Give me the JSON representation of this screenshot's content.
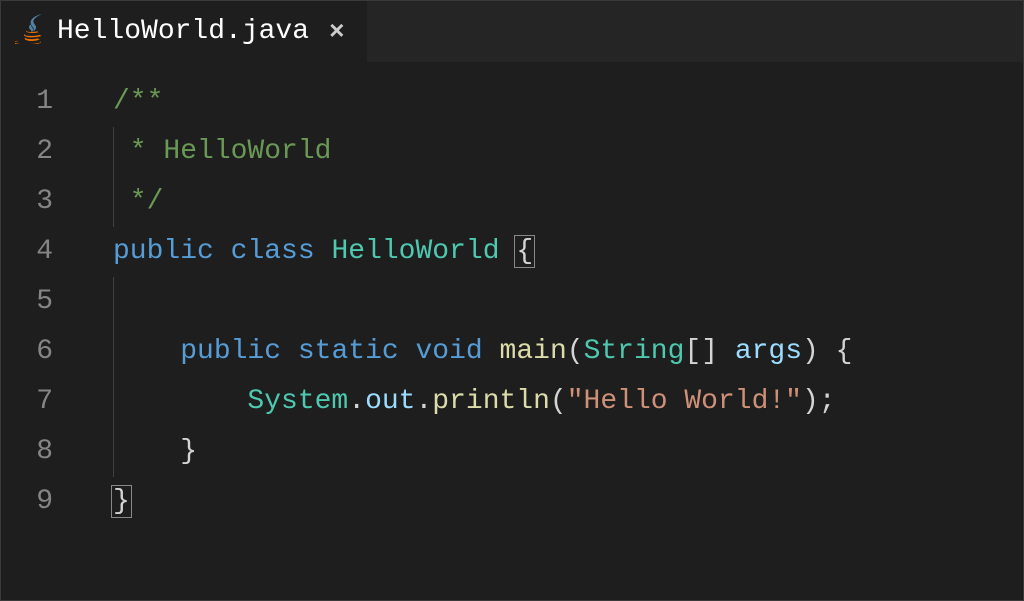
{
  "tab": {
    "filename": "HelloWorld.java",
    "icon": "java-icon"
  },
  "gutter": {
    "lines": [
      "1",
      "2",
      "3",
      "4",
      "5",
      "6",
      "7",
      "8",
      "9"
    ]
  },
  "code": {
    "l1": "/**",
    "l2_prefix": " * ",
    "l2_text": "HelloWorld",
    "l3": " */",
    "l4_kw1": "public",
    "l4_kw2": "class",
    "l4_type": "HelloWorld",
    "l4_brace": "{",
    "l6_kw1": "public",
    "l6_kw2": "static",
    "l6_kw3": "void",
    "l6_method": "main",
    "l6_p1": "(",
    "l6_type": "String",
    "l6_arr": "[] ",
    "l6_var": "args",
    "l6_p2": ") {",
    "l7_obj": "System",
    "l7_d1": ".",
    "l7_out": "out",
    "l7_d2": ".",
    "l7_println": "println",
    "l7_p1": "(",
    "l7_str": "\"Hello World!\"",
    "l7_p2": ");",
    "l8_brace": "}",
    "l9_brace": "}"
  }
}
